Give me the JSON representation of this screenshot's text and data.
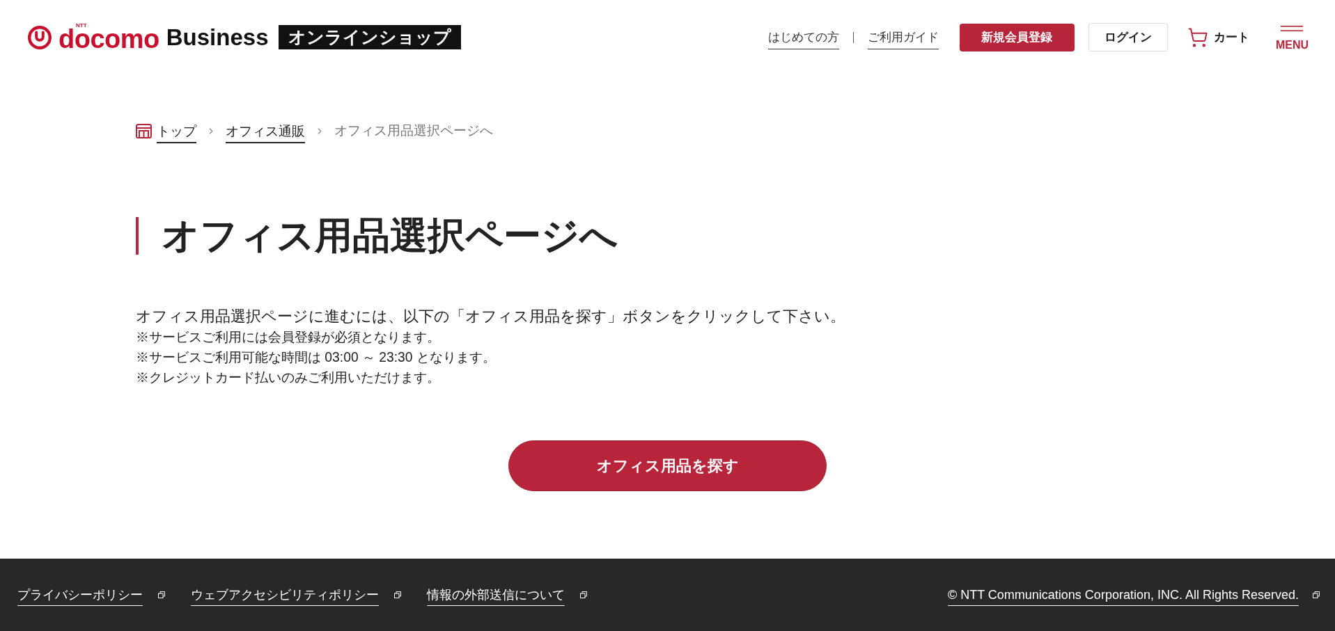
{
  "header": {
    "logo": {
      "corporate": "NTT",
      "brand": "docomo",
      "division": "Business",
      "badge": "オンラインショップ"
    },
    "nav_links": [
      "はじめての方",
      "ご利用ガイド"
    ],
    "register_button": "新規会員登録",
    "login_button": "ログイン",
    "cart_label": "カート",
    "menu_label": "MENU"
  },
  "breadcrumb": [
    {
      "label": "トップ",
      "current": false
    },
    {
      "label": "オフィス通販",
      "current": false
    },
    {
      "label": "オフィス用品選択ページへ",
      "current": true
    }
  ],
  "page_title": "オフィス用品選択ページへ",
  "intro": "オフィス用品選択ページに進むには、以下の「オフィス用品を探す」ボタンをクリックして下さい。",
  "notes": [
    "※サービスご利用には会員登録が必須となります。",
    "※サービスご利用可能な時間は 03:00 ～ 23:30 となります。",
    "※クレジットカード払いのみご利用いただけます。"
  ],
  "search_button": "オフィス用品を探す",
  "footer": {
    "links": [
      "プライバシーポリシー",
      "ウェブアクセシビリティポリシー",
      "情報の外部送信について"
    ],
    "copyright": "© NTT Communications Corporation, INC. All Rights Reserved."
  }
}
